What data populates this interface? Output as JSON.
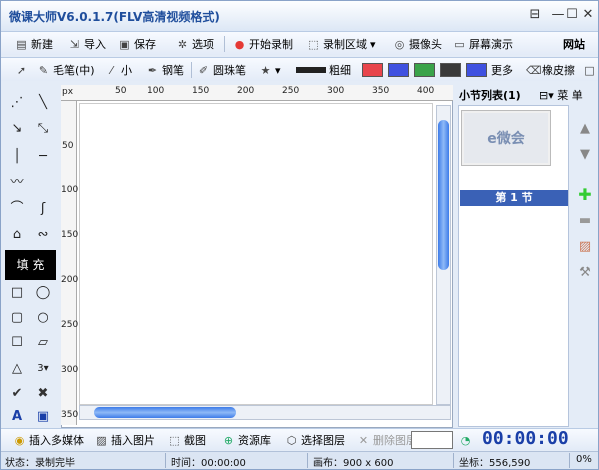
{
  "window": {
    "title": "微课大师V6.0.1.7(FLV高清视频格式)",
    "controls": [
      "⊟",
      "—",
      "☐",
      "✕"
    ]
  },
  "toolbar1": {
    "new": "新建",
    "import": "导入",
    "save": "保存",
    "options": "选项",
    "start_record": "开始录制",
    "record_area": "录制区域",
    "camera": "摄像头",
    "screen_demo": "屏幕演示",
    "website": "网站"
  },
  "toolbar2": {
    "brush": "毛笔(中)",
    "size": "小",
    "pen": "钢笔",
    "ballpoint": "圆珠笔",
    "thick": "粗细",
    "more": "更多",
    "eraser": "橡皮擦",
    "colors": [
      "#e8454c",
      "#3f51e0",
      "#3aa34a",
      "#3a3a3a",
      "#3f51e0"
    ]
  },
  "tools": {
    "fill_label": "填 充",
    "arrow_count": "3"
  },
  "ruler": {
    "unit": "px",
    "h_ticks": [
      "50",
      "100",
      "150",
      "200",
      "250",
      "300",
      "350",
      "400"
    ],
    "v_ticks": [
      "50",
      "100",
      "150",
      "200",
      "250",
      "300",
      "350"
    ]
  },
  "sections": {
    "header": "小节列表(1)",
    "menu": "菜 单",
    "item": "第 1 节",
    "thumb_text": "e微会"
  },
  "bottombar": {
    "insert_media": "插入多媒体",
    "insert_image": "插入图片",
    "screenshot": "截图",
    "library": "资源库",
    "select_layer": "选择图层",
    "delete_layer": "删除图层",
    "timer": "00:00:00"
  },
  "status": {
    "state": "状态：录制完毕",
    "time": "时间：00:00:00",
    "canvas": "画布：900 x 600",
    "coords": "坐标：556,590",
    "percent": "0%"
  }
}
